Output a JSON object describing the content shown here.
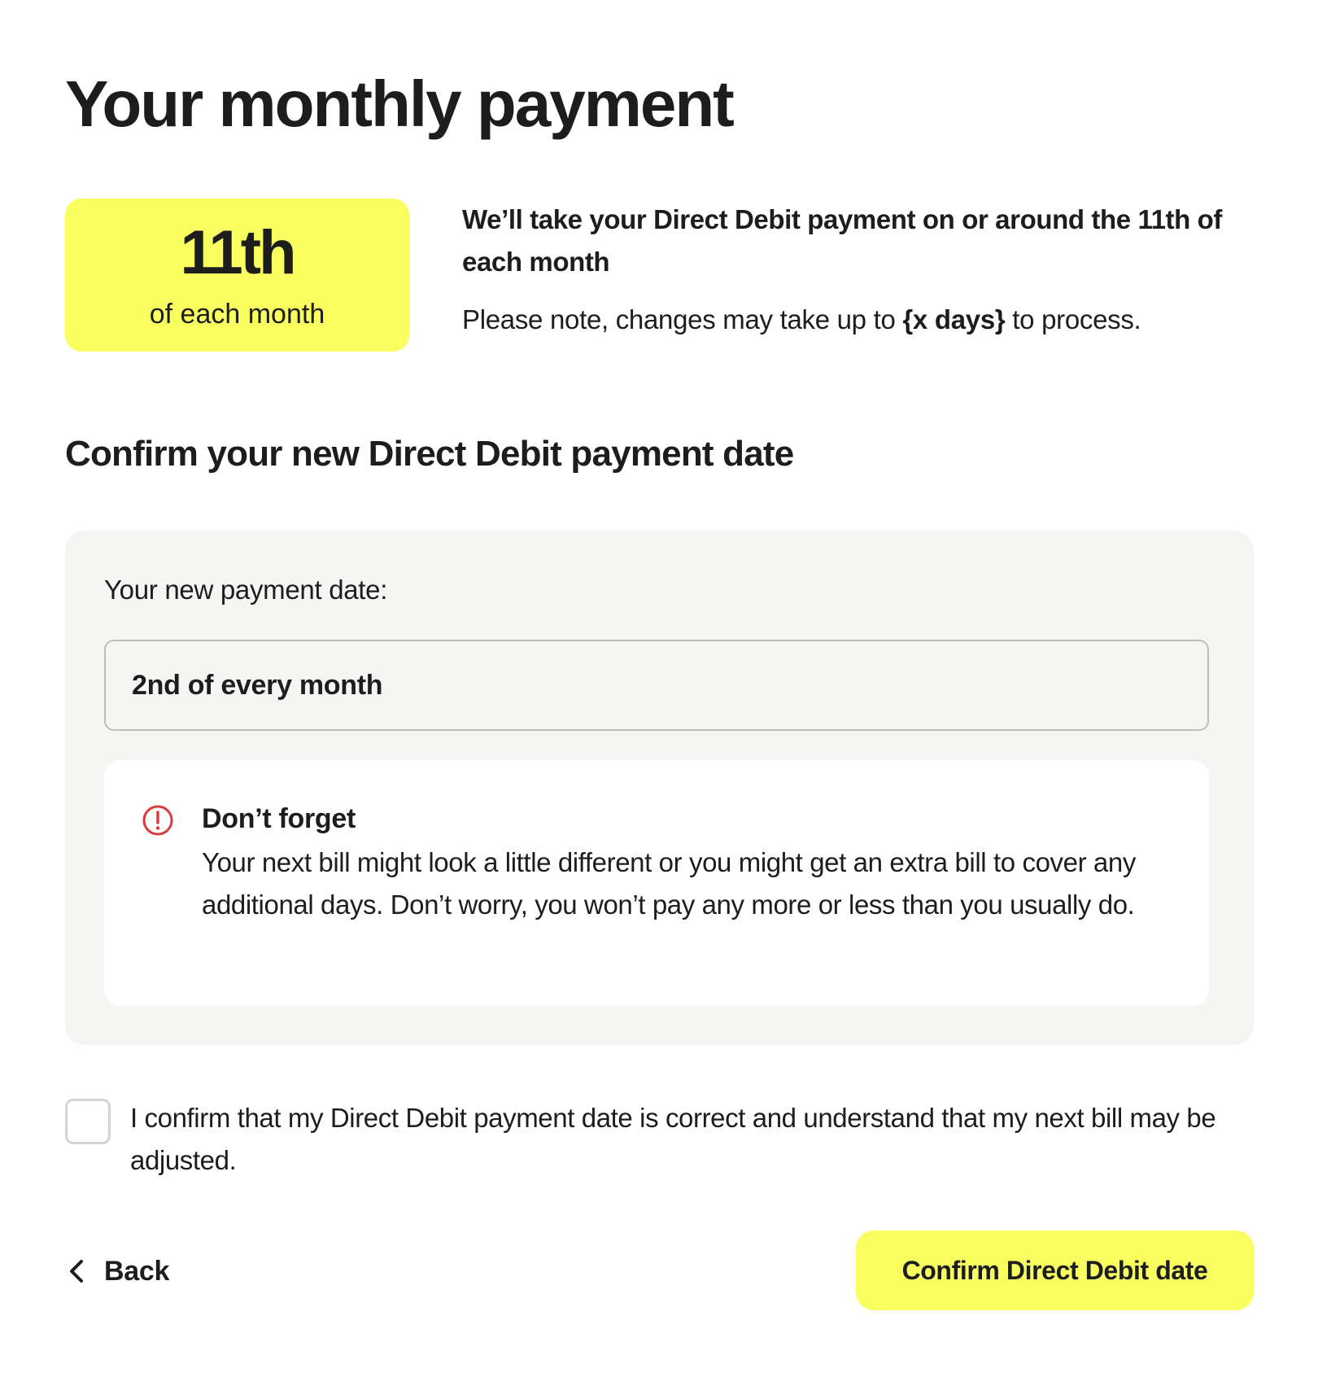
{
  "header": {
    "title": "Your monthly payment"
  },
  "current_payment": {
    "day": "11th",
    "subtitle": "of each month",
    "heading": "We’ll take your Direct Debit payment on or around the 11th of each month",
    "note_prefix": "Please note, changes may take up to ",
    "note_emphasis": "{x days}",
    "note_suffix": " to process."
  },
  "confirm_section": {
    "heading": "Confirm your new Direct Debit payment date",
    "field_label": "Your new payment date:",
    "field_value": "2nd of every month",
    "notice": {
      "icon": "alert-circle-icon",
      "title": "Don’t forget",
      "body": "Your next bill might look a little different or you might get an extra bill to cover any additional days. Don’t worry, you won’t pay any more or less than you usually do."
    },
    "checkbox": {
      "checked": false,
      "label": "I confirm that my Direct Debit payment date is correct and understand that my next bill may be adjusted."
    }
  },
  "actions": {
    "back_label": "Back",
    "back_icon": "chevron-left-icon",
    "confirm_label": "Confirm Direct Debit date"
  },
  "colors": {
    "accent_yellow": "#f9ff5e",
    "panel_grey": "#f5f5f3",
    "alert_red": "#d93a3a",
    "text": "#1d1d1d"
  }
}
